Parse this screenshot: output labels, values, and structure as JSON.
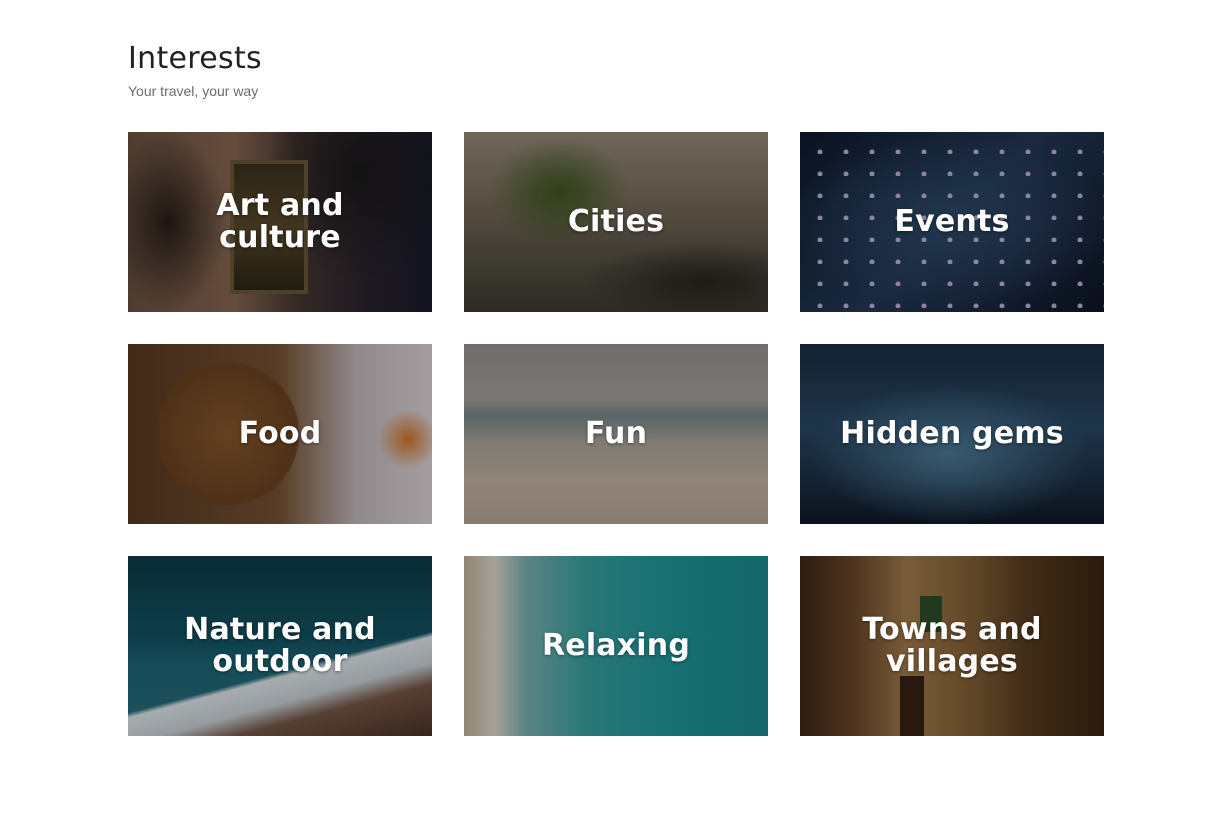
{
  "header": {
    "title": "Interests",
    "subtitle": "Your travel, your way"
  },
  "tiles": [
    {
      "label": "Art and culture"
    },
    {
      "label": "Cities"
    },
    {
      "label": "Events"
    },
    {
      "label": "Food"
    },
    {
      "label": "Fun"
    },
    {
      "label": "Hidden gems"
    },
    {
      "label": "Nature and\noutdoor"
    },
    {
      "label": "Relaxing"
    },
    {
      "label": "Towns and\nvillages"
    }
  ]
}
